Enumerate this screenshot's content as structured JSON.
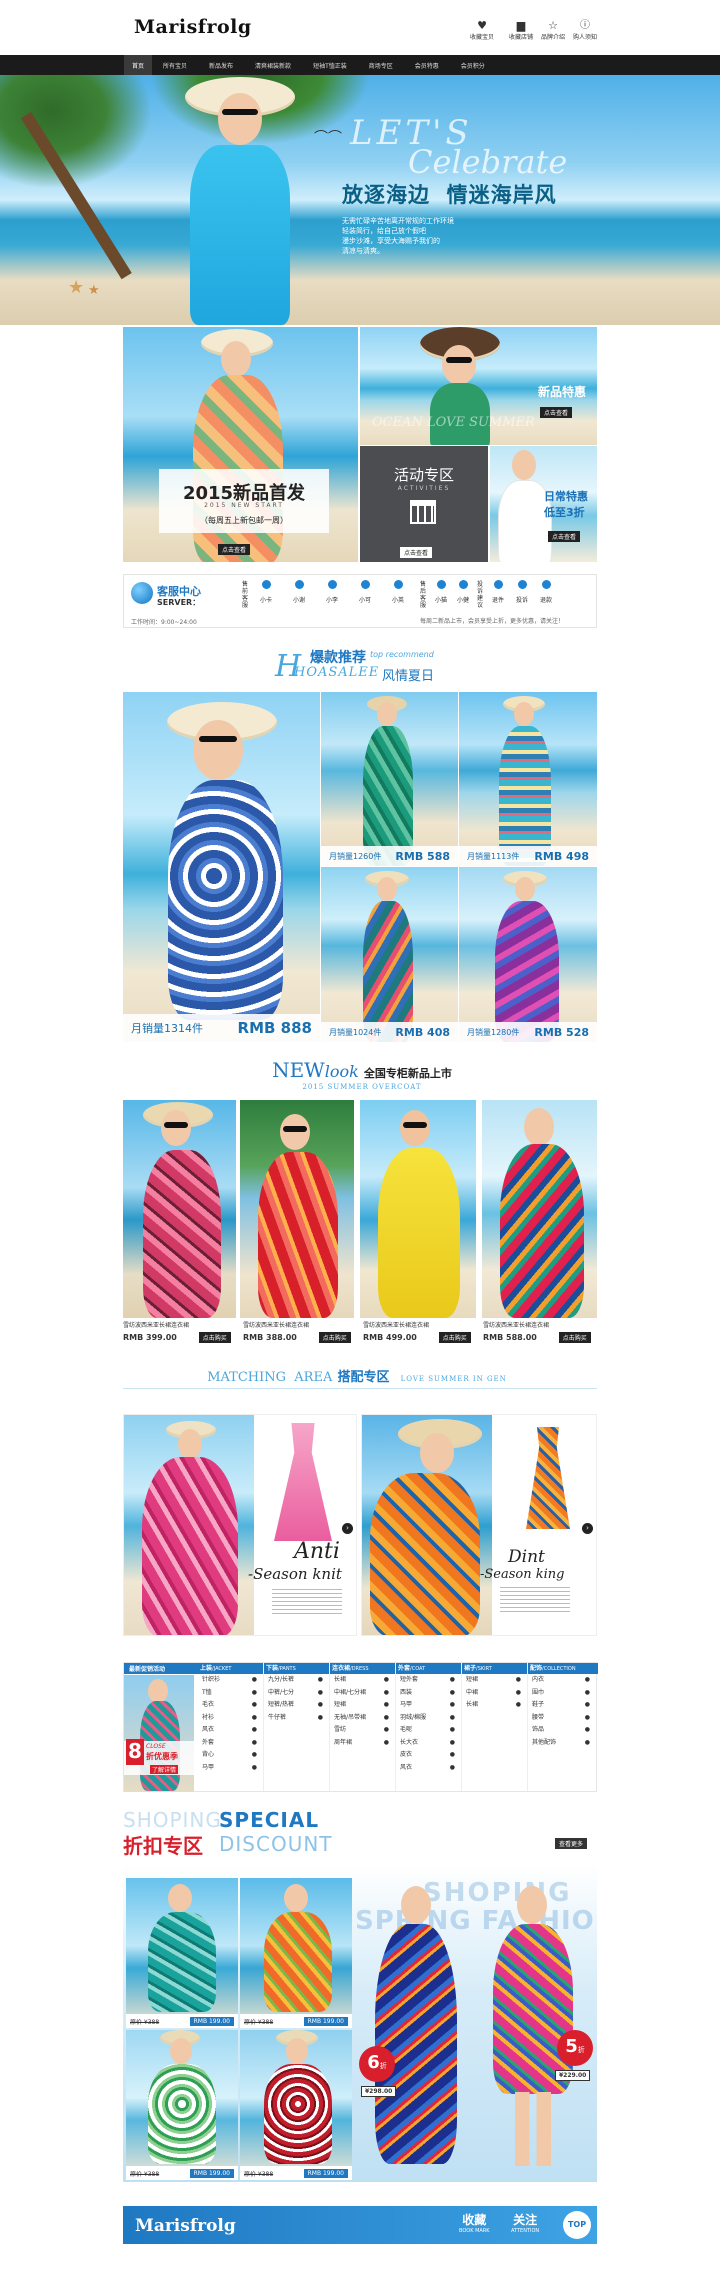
{
  "brand": "Marisfrolg",
  "header": {
    "icons": [
      {
        "name": "heart-icon",
        "label": "收藏宝贝"
      },
      {
        "name": "folder-icon",
        "label": "收藏店铺"
      },
      {
        "name": "star-icon",
        "label": "品牌介绍"
      },
      {
        "name": "info-icon",
        "label": "购人须知"
      }
    ]
  },
  "nav": [
    "首页",
    "所有宝贝",
    "新品发布",
    "清爽裙装新款",
    "短袖T恤正装",
    "商场专区",
    "会员特惠",
    "会员积分"
  ],
  "hero": {
    "line1": "LET'S",
    "line2": "Celebrate",
    "title": "放逐海边  情迷海岸风",
    "desc1": "无需忙碌辛苦地离开常规的工作环境",
    "desc2": "轻装简行，给自己放个假吧",
    "desc3": "漫步沙滩，享受大海赐予我们的",
    "desc4": "清凉与清爽。"
  },
  "promo": {
    "new_title": "2015新品首发",
    "new_en": "2015 NEW START",
    "new_sub": "（每周五上新包邮一周）",
    "new_btn": "点击查看",
    "member_title": "新品特惠",
    "member_btn": "点击查看",
    "activity_title": "活动专区",
    "activity_en": "ACTIVITIES",
    "activity_btn": "点击查看",
    "sale_title": "日常特惠",
    "sale_sub": "低至3折",
    "sale_btn": "点击查看",
    "ghost_text": "OCEAN LOVE SUMMER"
  },
  "service": {
    "title": "客服中心",
    "en": "SERVER：",
    "hours": "工作时间：9:00~24:00",
    "pre_label": "售前客服",
    "pre": [
      "小卡",
      "小谢",
      "小李",
      "小可",
      "小英"
    ],
    "after_label": "售后客服",
    "after": [
      "小猫",
      "小健"
    ],
    "complain_label": "投诉建议",
    "complain": [
      "退件",
      "投诉",
      "退款"
    ],
    "notice": "每周二新品上市，会员享受上折，更多优惠，请关注！"
  },
  "hot": {
    "title": "爆款推荐",
    "en": "top recommend",
    "big": "HOASALEE",
    "sub": "风情夏日",
    "items": [
      {
        "sales": "月销量1314件",
        "price": "RMB 888"
      },
      {
        "sales": "月销量1260件",
        "price": "RMB 588"
      },
      {
        "sales": "月销量1113件",
        "price": "RMB 498"
      },
      {
        "sales": "月销量1024件",
        "price": "RMB 408"
      },
      {
        "sales": "月销量1280件",
        "price": "RMB 528"
      }
    ]
  },
  "newlook": {
    "t1": "NEW",
    "t2": "look",
    "cn": "全国专柜新品上市",
    "en": "2015 SUMMER OVERCOAT",
    "items": [
      {
        "name": "雪纺波西米亚长裙连衣裙",
        "price": "RMB 399.00",
        "btn": "点击购买"
      },
      {
        "name": "雪纺波西米亚长裙连衣裙",
        "price": "RMB 388.00",
        "btn": "点击购买"
      },
      {
        "name": "雪纺波西米亚长裙连衣裙",
        "price": "RMB 499.00",
        "btn": "点击购买"
      },
      {
        "name": "雪纺波西米亚长裙连衣裙",
        "price": "RMB 588.00",
        "btn": "点击购买"
      }
    ]
  },
  "matching": {
    "title": "MATCHING  AREA",
    "cn": "搭配专区",
    "en": "LOVE SUMMER IN GEN",
    "left_t1": "Anti",
    "left_t2": "-Season knit",
    "right_t1": "Dint",
    "right_t2": "-Season king"
  },
  "catalog": {
    "left_title": "最新促销活动",
    "discount_num": "8",
    "discount_en": "CLOSE",
    "discount_cn": "折优惠季",
    "discount_btn": "了解详情",
    "cols": [
      {
        "head": "上装",
        "en": "/JACKET",
        "items": [
          "针织衫",
          "T恤",
          "毛衣",
          "衬衫",
          "风衣",
          "外套",
          "背心",
          "马甲"
        ]
      },
      {
        "head": "下装",
        "en": "/PANTS",
        "items": [
          "九分/长裤",
          "中裤/七分",
          "短裤/热裤",
          "牛仔裤"
        ]
      },
      {
        "head": "连衣裙",
        "en": "/DRESS",
        "items": [
          "长裙",
          "中裙/七分裙",
          "短裙",
          "无袖/吊带裙",
          "雪纺",
          "周年裙"
        ]
      },
      {
        "head": "外套",
        "en": "/COAT",
        "items": [
          "短外套",
          "西装",
          "马甲",
          "羽绒/棉服",
          "毛呢",
          "长大衣",
          "皮衣",
          "风衣"
        ]
      },
      {
        "head": "裙子",
        "en": "/SKIRT",
        "items": [
          "短裙",
          "中裙",
          "长裙"
        ]
      },
      {
        "head": "配饰",
        "en": "/COLLECTION",
        "items": [
          "内衣",
          "围巾",
          "鞋子",
          "腰带",
          "饰品",
          "其他配饰"
        ]
      }
    ]
  },
  "special": {
    "shoping": "SHOPING",
    "special": "SPECIAL",
    "cn": "折扣专区",
    "discount": "DISCOUNT",
    "more": "查看更多",
    "ghost1": "SHOPING",
    "ghost2": "SPRING FASHION",
    "items": [
      {
        "old": "原价 ¥388",
        "price": "RMB 199.00"
      },
      {
        "old": "原价 ¥388",
        "price": "RMB 199.00"
      },
      {
        "old": "原价 ¥388",
        "price": "RMB 199.00"
      },
      {
        "old": "原价 ¥388",
        "price": "RMB 199.00"
      }
    ],
    "b1_num": "6",
    "b1_unit": "折",
    "b1_price": "¥298.00",
    "b2_num": "5",
    "b2_unit": "折",
    "b2_price": "¥229.00"
  },
  "footer": {
    "brand": "Marisfrolg",
    "fav": "收藏",
    "fav_en": "BOOK MARK",
    "follow": "关注",
    "follow_en": "ATTENTION",
    "top": "TOP"
  },
  "colors": {
    "accent": "#1e78c2",
    "nav_bg": "#1b1b1b",
    "red": "#d81f2b"
  }
}
